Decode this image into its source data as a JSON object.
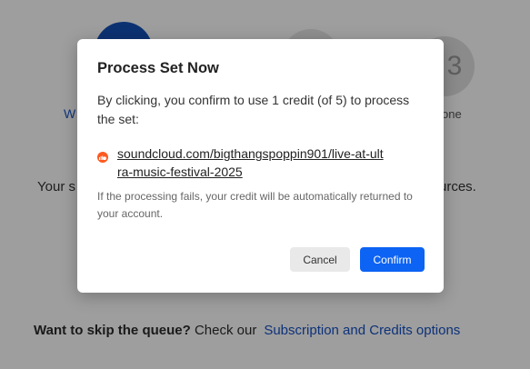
{
  "background": {
    "step1_label": "W",
    "step3_number": "3",
    "step3_label": "one",
    "left_fragment": "Your s",
    "right_fragment": "urces.",
    "skip_bold": "Want to skip the queue?",
    "skip_text": " Check our",
    "skip_link": "Subscription and Credits options"
  },
  "modal": {
    "title": "Process Set Now",
    "description": "By clicking, you confirm to use 1 credit (of 5) to process the set:",
    "url": "soundcloud.com/bigthangspoppin901/live-at-ultra-music-festival-2025",
    "source_icon": "soundcloud-icon",
    "fail_note": "If the processing fails, your credit will be automatically returned to your account.",
    "cancel_label": "Cancel",
    "confirm_label": "Confirm"
  },
  "colors": {
    "primary": "#0d63f3",
    "soundcloud": "#ff5a1f",
    "link": "#1651c4"
  }
}
